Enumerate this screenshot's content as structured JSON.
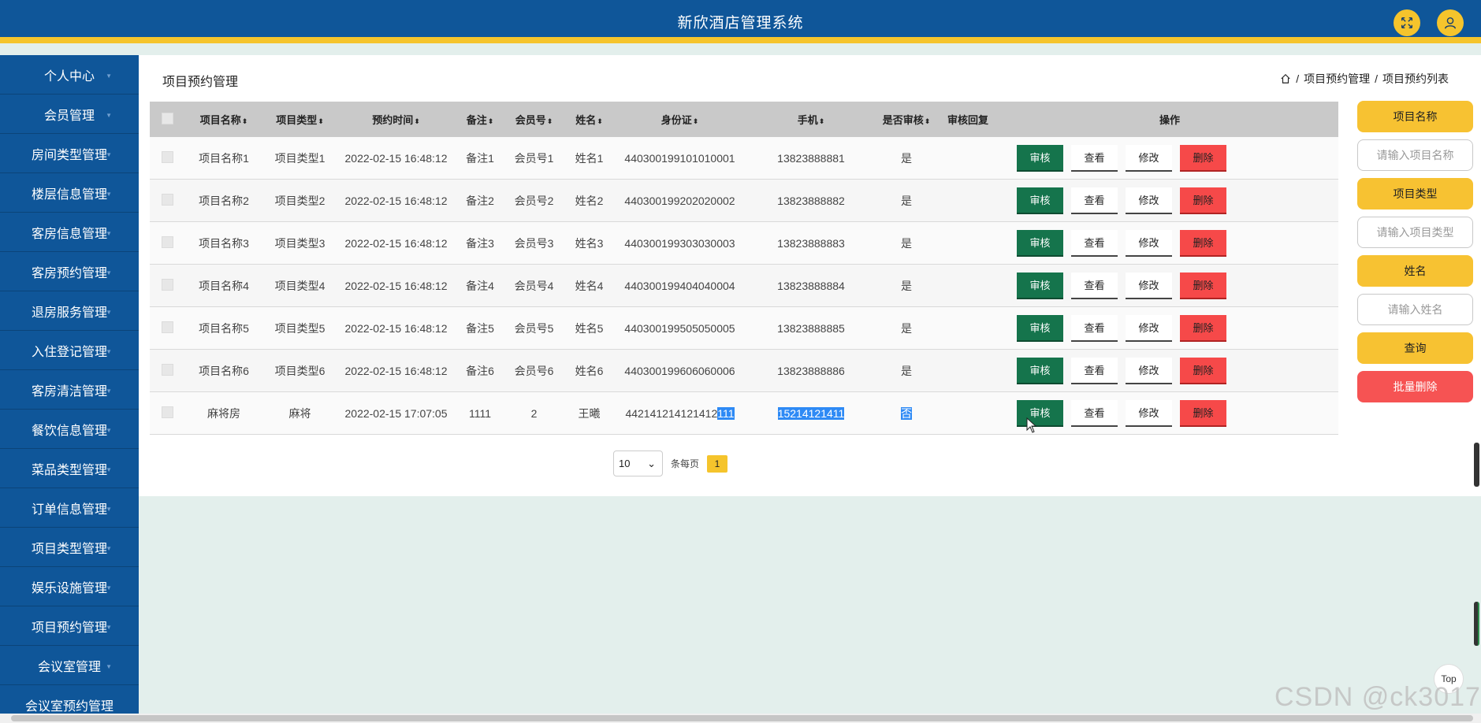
{
  "header": {
    "title": "新欣酒店管理系统",
    "icons": [
      "fullscreen-icon",
      "user-icon"
    ]
  },
  "sidebar": {
    "items": [
      {
        "label": "个人中心"
      },
      {
        "label": "会员管理"
      },
      {
        "label": "房间类型管理"
      },
      {
        "label": "楼层信息管理"
      },
      {
        "label": "客房信息管理"
      },
      {
        "label": "客房预约管理"
      },
      {
        "label": "退房服务管理"
      },
      {
        "label": "入住登记管理"
      },
      {
        "label": "客房清洁管理"
      },
      {
        "label": "餐饮信息管理"
      },
      {
        "label": "菜品类型管理"
      },
      {
        "label": "订单信息管理"
      },
      {
        "label": "项目类型管理"
      },
      {
        "label": "娱乐设施管理"
      },
      {
        "label": "项目预约管理"
      },
      {
        "label": "会议室管理"
      },
      {
        "label": "会议室预约管理"
      }
    ]
  },
  "page": {
    "title": "项目预约管理",
    "breadcrumb": [
      "项目预约管理",
      "项目预约列表"
    ],
    "breadcrumb_sep": "/"
  },
  "table": {
    "columns": [
      "项目名称",
      "项目类型",
      "预约时间",
      "备注",
      "会员号",
      "姓名",
      "身份证",
      "手机",
      "是否审核",
      "审核回复",
      "操作"
    ],
    "sort_glyph": "⬍",
    "rows": [
      {
        "name": "项目名称1",
        "type": "项目类型1",
        "time": "2022-02-15 16:48:12",
        "note": "备注1",
        "member": "会员号1",
        "person": "姓名1",
        "id_a": "440300199101010001",
        "id_b": "",
        "phone": "13823888881",
        "audit": "是",
        "reply": ""
      },
      {
        "name": "项目名称2",
        "type": "项目类型2",
        "time": "2022-02-15 16:48:12",
        "note": "备注2",
        "member": "会员号2",
        "person": "姓名2",
        "id_a": "440300199202020002",
        "id_b": "",
        "phone": "13823888882",
        "audit": "是",
        "reply": ""
      },
      {
        "name": "项目名称3",
        "type": "项目类型3",
        "time": "2022-02-15 16:48:12",
        "note": "备注3",
        "member": "会员号3",
        "person": "姓名3",
        "id_a": "440300199303030003",
        "id_b": "",
        "phone": "13823888883",
        "audit": "是",
        "reply": ""
      },
      {
        "name": "项目名称4",
        "type": "项目类型4",
        "time": "2022-02-15 16:48:12",
        "note": "备注4",
        "member": "会员号4",
        "person": "姓名4",
        "id_a": "440300199404040004",
        "id_b": "",
        "phone": "13823888884",
        "audit": "是",
        "reply": ""
      },
      {
        "name": "项目名称5",
        "type": "项目类型5",
        "time": "2022-02-15 16:48:12",
        "note": "备注5",
        "member": "会员号5",
        "person": "姓名5",
        "id_a": "440300199505050005",
        "id_b": "",
        "phone": "13823888885",
        "audit": "是",
        "reply": ""
      },
      {
        "name": "项目名称6",
        "type": "项目类型6",
        "time": "2022-02-15 16:48:12",
        "note": "备注6",
        "member": "会员号6",
        "person": "姓名6",
        "id_a": "440300199606060006",
        "id_b": "",
        "phone": "13823888886",
        "audit": "是",
        "reply": ""
      },
      {
        "name": "麻将房",
        "type": "麻将",
        "time": "2022-02-15 17:07:05",
        "note": "1111",
        "member": "2",
        "person": "王曦",
        "id_a": "442141214121412",
        "id_b": "111",
        "phone": "15214121411",
        "audit": "否",
        "reply": "",
        "highlight": true
      }
    ],
    "actions": {
      "audit": "审核",
      "view": "查看",
      "edit": "修改",
      "delete": "删除"
    }
  },
  "pagination": {
    "page_size": "10",
    "per_page_label": "条每页",
    "current_page": "1"
  },
  "search": {
    "fields": [
      {
        "label": "项目名称",
        "placeholder": "请输入项目名称"
      },
      {
        "label": "项目类型",
        "placeholder": "请输入项目类型"
      },
      {
        "label": "姓名",
        "placeholder": "请输入姓名"
      }
    ],
    "query_label": "查询",
    "bulk_delete_label": "批量删除"
  },
  "misc": {
    "top_label": "Top",
    "watermark": "CSDN @ck3017"
  },
  "colors": {
    "primary": "#0f5699",
    "accent": "#f5c42c",
    "audit": "#15744c",
    "danger": "#f64949",
    "highlight": "#2e8af5"
  }
}
